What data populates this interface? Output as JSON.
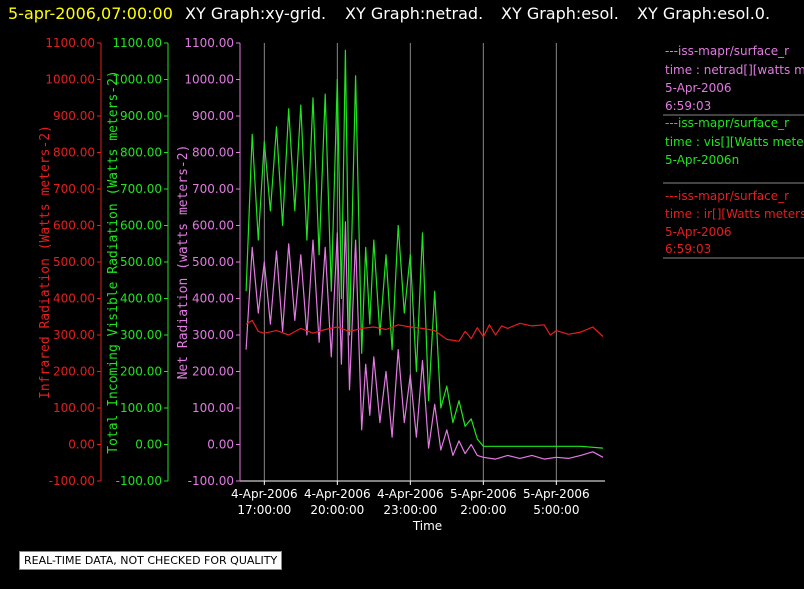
{
  "header": {
    "timestamp": "5-apr-2006,07:00:00",
    "graphs": [
      "XY Graph:xy-grid.",
      "XY Graph:netrad.",
      "XY Graph:esol.",
      "XY Graph:esol.0."
    ]
  },
  "notice": "REAL-TIME DATA, NOT CHECKED FOR QUALITY",
  "colors": {
    "netrad": "#e27ae2",
    "vis": "#1ee61e",
    "ir": "#e61e1e",
    "header_timestamp": "#ffff00",
    "grid": "#888888"
  },
  "legend": [
    {
      "line1": "---iss-mapr/surface_r",
      "line2": "time : netrad[][watts me",
      "line3": "5-Apr-2006",
      "line4": "6:59:03",
      "color": "#e27ae2"
    },
    {
      "line1": "---iss-mapr/surface_r",
      "line2": "time : vis[][Watts mete",
      "line3": "5-Apr-2006n",
      "line4": "",
      "color": "#1ee61e"
    },
    {
      "line1": "---iss-mapr/surface_r",
      "line2": "time : ir[][Watts meters",
      "line3": "5-Apr-2006",
      "line4": "6:59:03",
      "color": "#e61e1e"
    }
  ],
  "chart_data": {
    "type": "line",
    "xlabel": "Time",
    "x_range": [
      "2006-04-04 16:00",
      "2006-04-05 07:00"
    ],
    "x_ticks": [
      {
        "t": "2006-04-04 17:00",
        "line1": "4-Apr-2006",
        "line2": "17:00:00"
      },
      {
        "t": "2006-04-04 20:00",
        "line1": "4-Apr-2006",
        "line2": "20:00:00"
      },
      {
        "t": "2006-04-04 23:00",
        "line1": "4-Apr-2006",
        "line2": "23:00:00"
      },
      {
        "t": "2006-04-05 02:00",
        "line1": "5-Apr-2006",
        "line2": "2:00:00"
      },
      {
        "t": "2006-04-05 05:00",
        "line1": "5-Apr-2006",
        "line2": "5:00:00"
      }
    ],
    "ylim": [
      -100,
      1100
    ],
    "y_ticks": [
      "-100.00",
      "0.00",
      "100.00",
      "200.00",
      "300.00",
      "400.00",
      "500.00",
      "600.00",
      "700.00",
      "800.00",
      "900.00",
      "1000.00",
      "1100.00"
    ],
    "y_axes": [
      {
        "label": "Infrared Radiation (Watts meters-2)",
        "color": "#e61e1e"
      },
      {
        "label": "Total Incoming Visible Radiation (Watts meters-2)",
        "color": "#1ee61e"
      },
      {
        "label": "Net Radiation (watts meters-2)",
        "color": "#e27ae2"
      }
    ],
    "grid": true,
    "series": [
      {
        "key": "vis",
        "color": "#1ee61e",
        "points": [
          [
            "2006-04-04 16:15",
            420
          ],
          [
            "2006-04-04 16:30",
            850
          ],
          [
            "2006-04-04 16:45",
            560
          ],
          [
            "2006-04-04 17:00",
            830
          ],
          [
            "2006-04-04 17:15",
            640
          ],
          [
            "2006-04-04 17:30",
            870
          ],
          [
            "2006-04-04 17:45",
            600
          ],
          [
            "2006-04-04 18:00",
            920
          ],
          [
            "2006-04-04 18:15",
            640
          ],
          [
            "2006-04-04 18:30",
            930
          ],
          [
            "2006-04-04 18:45",
            560
          ],
          [
            "2006-04-04 19:00",
            950
          ],
          [
            "2006-04-04 19:15",
            520
          ],
          [
            "2006-04-04 19:30",
            960
          ],
          [
            "2006-04-04 19:45",
            420
          ],
          [
            "2006-04-04 20:00",
            1000
          ],
          [
            "2006-04-04 20:10",
            400
          ],
          [
            "2006-04-04 20:20",
            1080
          ],
          [
            "2006-04-04 20:30",
            300
          ],
          [
            "2006-04-04 20:45",
            1010
          ],
          [
            "2006-04-04 21:00",
            250
          ],
          [
            "2006-04-04 21:10",
            540
          ],
          [
            "2006-04-04 21:20",
            330
          ],
          [
            "2006-04-04 21:30",
            560
          ],
          [
            "2006-04-04 21:45",
            300
          ],
          [
            "2006-04-04 22:00",
            520
          ],
          [
            "2006-04-04 22:15",
            260
          ],
          [
            "2006-04-04 22:30",
            600
          ],
          [
            "2006-04-04 22:45",
            360
          ],
          [
            "2006-04-04 23:00",
            520
          ],
          [
            "2006-04-04 23:15",
            200
          ],
          [
            "2006-04-04 23:30",
            580
          ],
          [
            "2006-04-04 23:45",
            120
          ],
          [
            "2006-04-05 00:00",
            420
          ],
          [
            "2006-04-05 00:15",
            100
          ],
          [
            "2006-04-05 00:30",
            160
          ],
          [
            "2006-04-05 00:45",
            60
          ],
          [
            "2006-04-05 01:00",
            120
          ],
          [
            "2006-04-05 01:15",
            50
          ],
          [
            "2006-04-05 01:30",
            70
          ],
          [
            "2006-04-05 01:45",
            15
          ],
          [
            "2006-04-05 02:00",
            -5
          ],
          [
            "2006-04-05 03:00",
            -5
          ],
          [
            "2006-04-05 04:00",
            -5
          ],
          [
            "2006-04-05 05:00",
            -5
          ],
          [
            "2006-04-05 06:00",
            -5
          ],
          [
            "2006-04-05 06:55",
            -10
          ]
        ]
      },
      {
        "key": "netrad",
        "color": "#e27ae2",
        "points": [
          [
            "2006-04-04 16:15",
            260
          ],
          [
            "2006-04-04 16:30",
            540
          ],
          [
            "2006-04-04 16:45",
            360
          ],
          [
            "2006-04-04 17:00",
            500
          ],
          [
            "2006-04-04 17:15",
            330
          ],
          [
            "2006-04-04 17:30",
            530
          ],
          [
            "2006-04-04 17:45",
            310
          ],
          [
            "2006-04-04 18:00",
            550
          ],
          [
            "2006-04-04 18:15",
            340
          ],
          [
            "2006-04-04 18:30",
            520
          ],
          [
            "2006-04-04 18:45",
            300
          ],
          [
            "2006-04-04 19:00",
            560
          ],
          [
            "2006-04-04 19:15",
            280
          ],
          [
            "2006-04-04 19:30",
            540
          ],
          [
            "2006-04-04 19:45",
            240
          ],
          [
            "2006-04-04 20:00",
            580
          ],
          [
            "2006-04-04 20:10",
            220
          ],
          [
            "2006-04-04 20:20",
            610
          ],
          [
            "2006-04-04 20:30",
            150
          ],
          [
            "2006-04-04 20:45",
            560
          ],
          [
            "2006-04-04 21:00",
            40
          ],
          [
            "2006-04-04 21:10",
            220
          ],
          [
            "2006-04-04 21:20",
            80
          ],
          [
            "2006-04-04 21:30",
            240
          ],
          [
            "2006-04-04 21:45",
            60
          ],
          [
            "2006-04-04 22:00",
            200
          ],
          [
            "2006-04-04 22:15",
            20
          ],
          [
            "2006-04-04 22:30",
            260
          ],
          [
            "2006-04-04 22:45",
            60
          ],
          [
            "2006-04-04 23:00",
            190
          ],
          [
            "2006-04-04 23:15",
            20
          ],
          [
            "2006-04-04 23:30",
            230
          ],
          [
            "2006-04-04 23:45",
            -10
          ],
          [
            "2006-04-05 00:00",
            110
          ],
          [
            "2006-04-05 00:15",
            -15
          ],
          [
            "2006-04-05 00:30",
            40
          ],
          [
            "2006-04-05 00:45",
            -30
          ],
          [
            "2006-04-05 01:00",
            10
          ],
          [
            "2006-04-05 01:15",
            -25
          ],
          [
            "2006-04-05 01:30",
            0
          ],
          [
            "2006-04-05 01:45",
            -30
          ],
          [
            "2006-04-05 02:00",
            -35
          ],
          [
            "2006-04-05 02:30",
            -40
          ],
          [
            "2006-04-05 03:00",
            -30
          ],
          [
            "2006-04-05 03:30",
            -38
          ],
          [
            "2006-04-05 04:00",
            -30
          ],
          [
            "2006-04-05 04:30",
            -40
          ],
          [
            "2006-04-05 05:00",
            -35
          ],
          [
            "2006-04-05 05:30",
            -38
          ],
          [
            "2006-04-05 06:00",
            -30
          ],
          [
            "2006-04-05 06:30",
            -20
          ],
          [
            "2006-04-05 06:55",
            -35
          ]
        ]
      },
      {
        "key": "ir",
        "color": "#e61e1e",
        "points": [
          [
            "2006-04-04 16:15",
            330
          ],
          [
            "2006-04-04 16:30",
            340
          ],
          [
            "2006-04-04 16:45",
            310
          ],
          [
            "2006-04-04 17:00",
            305
          ],
          [
            "2006-04-04 17:30",
            312
          ],
          [
            "2006-04-04 18:00",
            300
          ],
          [
            "2006-04-04 18:30",
            318
          ],
          [
            "2006-04-04 19:00",
            305
          ],
          [
            "2006-04-04 19:30",
            315
          ],
          [
            "2006-04-04 20:00",
            322
          ],
          [
            "2006-04-04 20:30",
            310
          ],
          [
            "2006-04-04 21:00",
            318
          ],
          [
            "2006-04-04 21:30",
            322
          ],
          [
            "2006-04-04 22:00",
            315
          ],
          [
            "2006-04-04 22:30",
            328
          ],
          [
            "2006-04-04 23:00",
            322
          ],
          [
            "2006-04-04 23:30",
            318
          ],
          [
            "2006-04-05 00:00",
            312
          ],
          [
            "2006-04-05 00:30",
            288
          ],
          [
            "2006-04-05 01:00",
            283
          ],
          [
            "2006-04-05 01:15",
            310
          ],
          [
            "2006-04-05 01:30",
            290
          ],
          [
            "2006-04-05 01:45",
            320
          ],
          [
            "2006-04-05 02:00",
            295
          ],
          [
            "2006-04-05 02:15",
            328
          ],
          [
            "2006-04-05 02:30",
            300
          ],
          [
            "2006-04-05 02:45",
            325
          ],
          [
            "2006-04-05 03:00",
            318
          ],
          [
            "2006-04-05 03:30",
            332
          ],
          [
            "2006-04-05 04:00",
            325
          ],
          [
            "2006-04-05 04:30",
            328
          ],
          [
            "2006-04-05 04:45",
            300
          ],
          [
            "2006-04-05 05:00",
            312
          ],
          [
            "2006-04-05 05:30",
            302
          ],
          [
            "2006-04-05 06:00",
            308
          ],
          [
            "2006-04-05 06:30",
            322
          ],
          [
            "2006-04-05 06:55",
            296
          ]
        ]
      }
    ]
  }
}
